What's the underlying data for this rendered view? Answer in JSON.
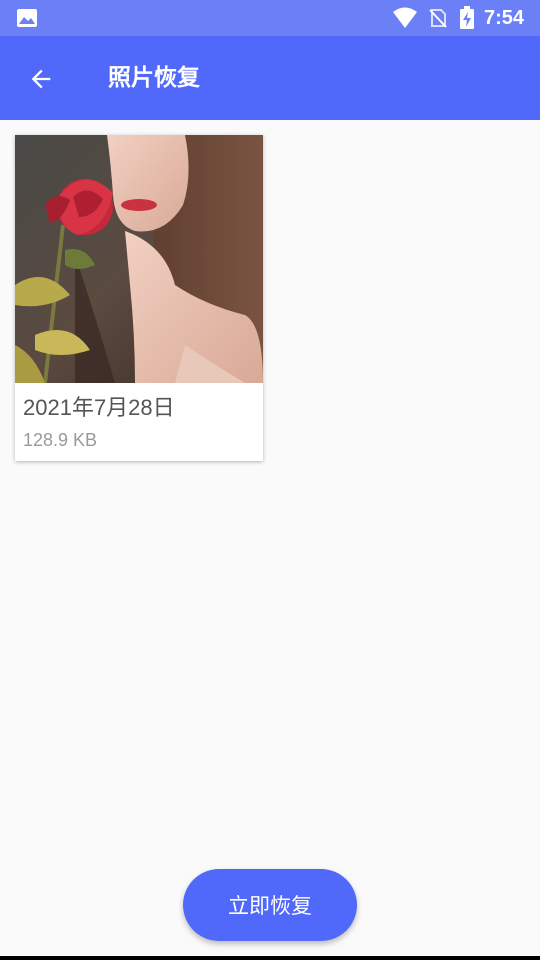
{
  "status_bar": {
    "time": "7:54",
    "icons": [
      "gallery-icon",
      "wifi-icon",
      "no-sim-icon",
      "battery-charging-icon"
    ],
    "color": "#6b7ff7"
  },
  "app_bar": {
    "title": "照片恢复",
    "back_icon": "arrow-left-icon",
    "color": "#5069fb"
  },
  "photos": [
    {
      "date": "2021年7月28日",
      "size": "128.9 KB"
    }
  ],
  "actions": {
    "restore_label": "立即恢复",
    "color": "#5069fb"
  }
}
